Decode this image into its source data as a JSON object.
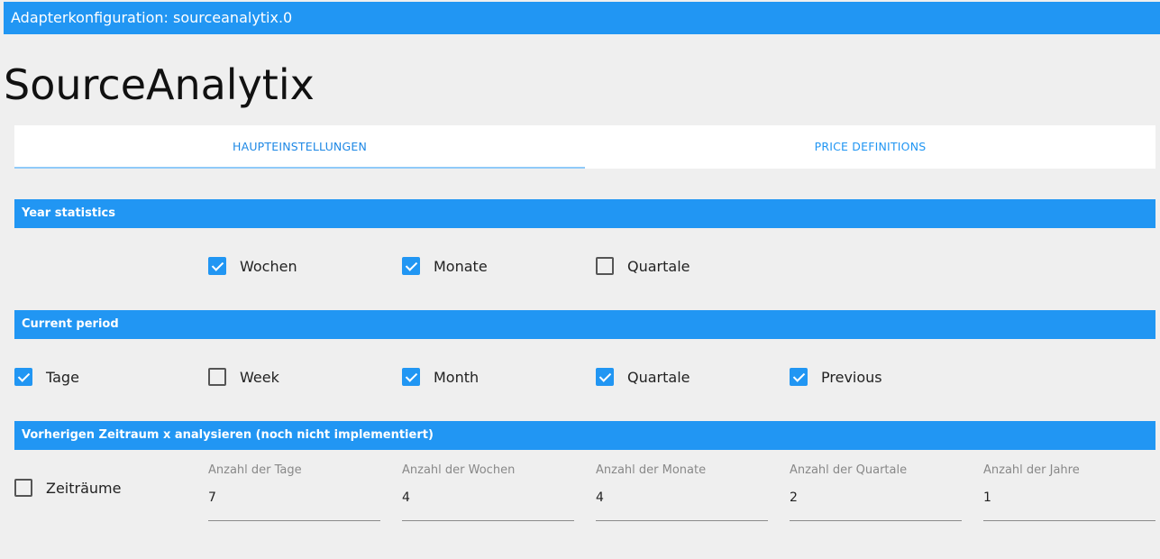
{
  "window": {
    "title": "Adapterkonfiguration: sourceanalytix.0"
  },
  "app": {
    "title": "SourceAnalytix"
  },
  "tabs": [
    {
      "label": "HAUPTEINSTELLUNGEN",
      "active": true
    },
    {
      "label": "PRICE DEFINITIONS",
      "active": false
    }
  ],
  "year_statistics": {
    "header": "Year statistics",
    "options": [
      {
        "label": "Wochen",
        "checked": true
      },
      {
        "label": "Monate",
        "checked": true
      },
      {
        "label": "Quartale",
        "checked": false
      }
    ]
  },
  "current_period": {
    "header": "Current period",
    "options": [
      {
        "label": "Tage",
        "checked": true
      },
      {
        "label": "Week",
        "checked": false
      },
      {
        "label": "Month",
        "checked": true
      },
      {
        "label": "Quartale",
        "checked": true
      },
      {
        "label": "Previous",
        "checked": true
      }
    ]
  },
  "previous_period": {
    "header": "Vorherigen Zeitraum x analysieren (noch nicht implementiert)",
    "checkbox": {
      "label": "Zeiträume",
      "checked": false
    },
    "fields": [
      {
        "label": "Anzahl der Tage",
        "value": "7"
      },
      {
        "label": "Anzahl der Wochen",
        "value": "4"
      },
      {
        "label": "Anzahl der Monate",
        "value": "4"
      },
      {
        "label": "Anzahl der Quartale",
        "value": "2"
      },
      {
        "label": "Anzahl der Jahre",
        "value": "1"
      }
    ]
  },
  "colors": {
    "accent": "#2196f3",
    "background": "#efefef"
  }
}
